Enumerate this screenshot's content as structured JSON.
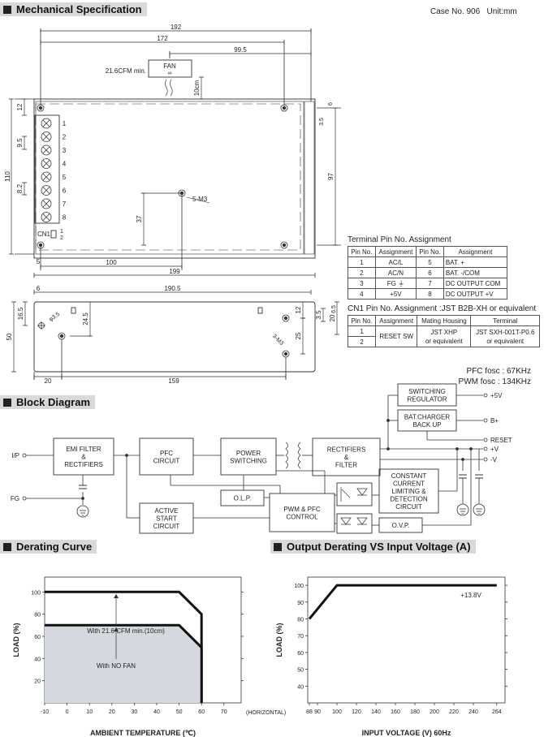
{
  "mechanical": {
    "title": "Mechanical Specification",
    "case_no": "Case No. 906",
    "unit": "Unit:mm",
    "top_view": {
      "dims": [
        "192",
        "172",
        "99.5",
        "110",
        "12",
        "9.5",
        "8.2",
        "37",
        "97",
        "6",
        "3.5",
        "5",
        "100",
        "199",
        "10cm"
      ],
      "fan_label": "FAN",
      "fan_note": "21.6CFM min.",
      "screw_label": "5-M3",
      "terminal_numbers": [
        "1",
        "2",
        "3",
        "4",
        "5",
        "6",
        "7",
        "8"
      ],
      "cn1_label": "CN1",
      "cn1_pins": [
        "1",
        "2"
      ]
    },
    "side_view": {
      "dims": [
        "6",
        "190.5",
        "50",
        "16.5",
        "24.5",
        "12",
        "25",
        "3.5",
        "6.5",
        "20",
        "20",
        "159"
      ],
      "hole_label": "φ3.5",
      "screw_label": "3-M3"
    }
  },
  "terminal_table": {
    "title": "Terminal Pin No.  Assignment",
    "headers": [
      "Pin No.",
      "Assignment",
      "Pin No.",
      "Assignment"
    ],
    "rows": [
      [
        "1",
        "AC/L",
        "5",
        "BAT. +"
      ],
      [
        "2",
        "AC/N",
        "6",
        "BAT. -/COM"
      ],
      [
        "3",
        "FG ⏚",
        "7",
        "DC OUTPUT COM"
      ],
      [
        "4",
        "+5V",
        "8",
        "DC OUTPUT +V"
      ]
    ]
  },
  "cn1_table": {
    "title": "CN1 Pin No.  Assignment :JST B2B-XH or equivalent",
    "headers": [
      "Pin No.",
      "Assignment",
      "Mating Housing",
      "Terminal"
    ],
    "pins": [
      "1",
      "2"
    ],
    "assignment": "RESET SW",
    "housing": [
      "JST XHP",
      "or equivalent"
    ],
    "terminal": [
      "JST SXH-001T-P0.6",
      "or equivalent"
    ]
  },
  "frequencies": {
    "pfc": "PFC fosc : 67KHz",
    "pwm": "PWM fosc : 134KHz"
  },
  "block_diagram": {
    "title": "Block Diagram",
    "blocks": {
      "emi": [
        "EMI FILTER",
        "&",
        "RECTIFIERS"
      ],
      "pfc": [
        "PFC",
        "CIRCUIT"
      ],
      "power": [
        "POWER",
        "SWITCHING"
      ],
      "rect": [
        "RECTIFIERS",
        "&",
        "FILTER"
      ],
      "swreg": [
        "SWITCHING",
        "REGULATOR"
      ],
      "batchg": [
        "BAT.CHARGER",
        "BACK UP"
      ],
      "cc": [
        "CONSTANT",
        "CURRENT",
        "LIMITING &",
        "DETECTION",
        "CIRCUIT"
      ],
      "olp": [
        "O.L.P."
      ],
      "pwm": [
        "PWM & PFC",
        "CONTROL"
      ],
      "active": [
        "ACTIVE",
        "START",
        "CIRCUIT"
      ],
      "ovp": [
        "O.V.P."
      ]
    },
    "terminals": {
      "ip": "I/P",
      "fg": "FG",
      "v5": "+5V",
      "bplus": "B+",
      "reset": "RESET",
      "vplus": "+V",
      "vminus": "-V"
    }
  },
  "derating_header": "Derating Curve",
  "input_header": "Output Derating VS Input Voltage (A)",
  "chart_data": [
    {
      "type": "line",
      "xlabel": "AMBIENT TEMPERATURE (℃)",
      "ylabel": "LOAD (%)",
      "x_ticks": [
        "-10",
        "0",
        "10",
        "20",
        "30",
        "40",
        "50",
        "60",
        "70"
      ],
      "x_extra_label": "(HORIZONTAL)",
      "y_ticks": [
        "20",
        "40",
        "60",
        "80",
        "100"
      ],
      "xlim": [
        -10,
        77
      ],
      "ylim": [
        0,
        113
      ],
      "grid": false,
      "series": [
        {
          "name": "With 21.6 CFM min.(10cm)",
          "x": [
            -10,
            50,
            60,
            60
          ],
          "y": [
            100,
            100,
            80,
            0
          ]
        },
        {
          "name": "With NO FAN",
          "x": [
            -10,
            50,
            60,
            60
          ],
          "y": [
            70,
            70,
            50,
            0
          ],
          "fill": "#d5d8de"
        }
      ]
    },
    {
      "type": "line",
      "xlabel": "INPUT VOLTAGE (V) 60Hz",
      "ylabel": "LOAD (%)",
      "x_ticks": [
        "88",
        "90",
        "100",
        "120",
        "140",
        "160",
        "180",
        "200",
        "220",
        "240",
        "264"
      ],
      "y_ticks": [
        "40",
        "50",
        "60",
        "70",
        "80",
        "90",
        "100"
      ],
      "ylim": [
        30,
        107
      ],
      "grid": false,
      "annotation": "+13.8V",
      "series": [
        {
          "x": [
            88,
            100,
            264
          ],
          "y": [
            80,
            100,
            100
          ]
        }
      ]
    }
  ]
}
